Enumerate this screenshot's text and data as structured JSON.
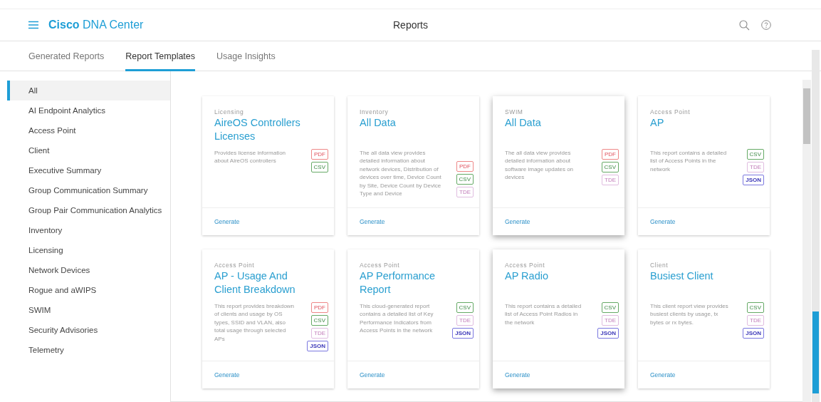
{
  "header": {
    "brand_bold": "Cisco",
    "brand_rest": "DNA Center",
    "title": "Reports"
  },
  "tabs": [
    {
      "label": "Generated Reports",
      "selected": false
    },
    {
      "label": "Report Templates",
      "selected": true
    },
    {
      "label": "Usage Insights",
      "selected": false
    }
  ],
  "sidebar": {
    "items": [
      {
        "label": "All",
        "selected": true
      },
      {
        "label": "AI Endpoint Analytics",
        "selected": false
      },
      {
        "label": "Access Point",
        "selected": false
      },
      {
        "label": "Client",
        "selected": false
      },
      {
        "label": "Executive Summary",
        "selected": false
      },
      {
        "label": "Group Communication Summary",
        "selected": false
      },
      {
        "label": "Group Pair Communication Analytics",
        "selected": false
      },
      {
        "label": "Inventory",
        "selected": false
      },
      {
        "label": "Licensing",
        "selected": false
      },
      {
        "label": "Network Devices",
        "selected": false
      },
      {
        "label": "Rogue and aWIPS",
        "selected": false
      },
      {
        "label": "SWIM",
        "selected": false
      },
      {
        "label": "Security Advisories",
        "selected": false
      },
      {
        "label": "Telemetry",
        "selected": false
      }
    ]
  },
  "cards": [
    {
      "category": "Licensing",
      "title": "AireOS Controllers Licenses",
      "description": "Provides license information about AireOS controllers",
      "formats": [
        {
          "label": "PDF",
          "kind": "pdf"
        },
        {
          "label": "CSV",
          "kind": "csv"
        }
      ],
      "action": "Generate",
      "elevated": false
    },
    {
      "category": "Inventory",
      "title": "All Data",
      "description": "The all data view provides detailed information about network devices, Distribution of devices over time, Device Count by Site, Device Count by Device Type and Device",
      "formats": [
        {
          "label": "PDF",
          "kind": "pdf"
        },
        {
          "label": "CSV",
          "kind": "csv"
        },
        {
          "label": "TDE",
          "kind": "tde"
        }
      ],
      "action": "Generate",
      "elevated": false
    },
    {
      "category": "SWIM",
      "title": "All Data",
      "description": "The all data view provides detailed information about software image updates on devices",
      "formats": [
        {
          "label": "PDF",
          "kind": "pdf"
        },
        {
          "label": "CSV",
          "kind": "csv"
        },
        {
          "label": "TDE",
          "kind": "tde"
        }
      ],
      "action": "Generate",
      "elevated": true
    },
    {
      "category": "Access Point",
      "title": "AP",
      "description": "This report contains a detailed list of Access Points in the network",
      "formats": [
        {
          "label": "CSV",
          "kind": "csv"
        },
        {
          "label": "TDE",
          "kind": "tde"
        },
        {
          "label": "JSON",
          "kind": "json"
        }
      ],
      "action": "Generate",
      "elevated": false
    },
    {
      "category": "Access Point",
      "title": "AP - Usage And Client Breakdown",
      "description": "This report provides breakdown of clients and usage by OS types, SSID and VLAN, also total usage through selected APs",
      "formats": [
        {
          "label": "PDF",
          "kind": "pdf"
        },
        {
          "label": "CSV",
          "kind": "csv"
        },
        {
          "label": "TDE",
          "kind": "tde"
        },
        {
          "label": "JSON",
          "kind": "json"
        }
      ],
      "action": "Generate",
      "elevated": false
    },
    {
      "category": "Access Point",
      "title": "AP Performance Report",
      "description": "This cloud-generated report contains a detailed list of Key Performance Indicators from Access Points in the network",
      "formats": [
        {
          "label": "CSV",
          "kind": "csv"
        },
        {
          "label": "TDE",
          "kind": "tde"
        },
        {
          "label": "JSON",
          "kind": "json"
        }
      ],
      "action": "Generate",
      "elevated": false
    },
    {
      "category": "Access Point",
      "title": "AP Radio",
      "description": "This report contains a detailed list of Access Point Radios in the network",
      "formats": [
        {
          "label": "CSV",
          "kind": "csv"
        },
        {
          "label": "TDE",
          "kind": "tde"
        },
        {
          "label": "JSON",
          "kind": "json"
        }
      ],
      "action": "Generate",
      "elevated": true
    },
    {
      "category": "Client",
      "title": "Busiest Client",
      "description": "This client report view provides busiest clients by usage, tx bytes or rx bytes.",
      "formats": [
        {
          "label": "CSV",
          "kind": "csv"
        },
        {
          "label": "TDE",
          "kind": "tde"
        },
        {
          "label": "JSON",
          "kind": "json"
        }
      ],
      "action": "Generate",
      "elevated": false
    }
  ]
}
